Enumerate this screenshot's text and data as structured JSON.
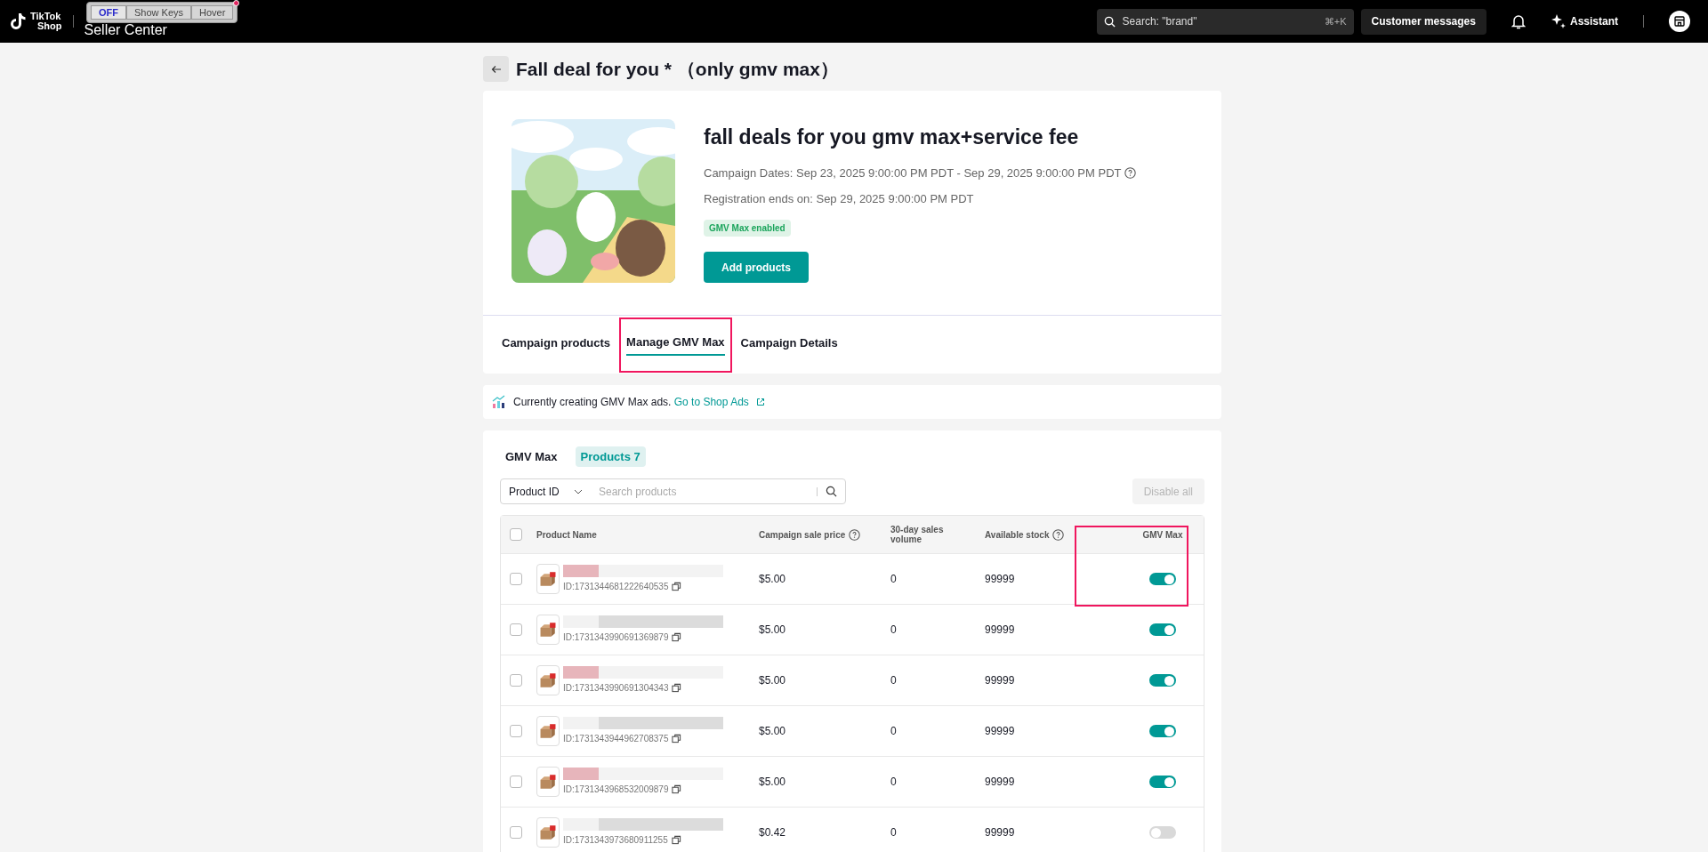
{
  "topbar": {
    "logo_line1": "TikTok",
    "logo_line2": "Shop",
    "app_name": "Seller Center",
    "overlay_toolbar": [
      {
        "label": "OFF",
        "selected": true
      },
      {
        "label": "Show Keys",
        "selected": false
      },
      {
        "label": "Hover",
        "selected": false
      }
    ],
    "search": {
      "placeholder": "Search: \"brand\"",
      "shortcut": "⌘+K"
    },
    "messages_button": "Customer messages",
    "assistant_button": "Assistant"
  },
  "page_title": "Fall deal for you * （only gmv max）",
  "campaign": {
    "title": "fall deals for you gmv max+service fee",
    "dates": "Campaign Dates: Sep 23, 2025 9:00:00 PM PDT - Sep 29, 2025 9:00:00 PM PDT",
    "registration": "Registration ends on: Sep 29, 2025 9:00:00 PM PDT",
    "badge": "GMV Max enabled",
    "add_button": "Add products"
  },
  "tabs": [
    {
      "label": "Campaign products",
      "selected": false
    },
    {
      "label": "Manage GMV Max",
      "selected": true
    },
    {
      "label": "Campaign Details",
      "selected": false
    }
  ],
  "banner": {
    "text": "Currently creating GMV Max ads.",
    "link": "Go to Shop Ads"
  },
  "subtabs": [
    {
      "label": "GMV Max",
      "selected": false
    },
    {
      "label": "Products 7",
      "selected": true
    }
  ],
  "filter": {
    "select": "Product ID",
    "placeholder": "Search products"
  },
  "disable_all": {
    "label": "Disable all",
    "disabled": true
  },
  "table": {
    "select_all_checked": false,
    "columns": [
      "Product Name",
      "Campaign sale price",
      "30-day sales volume",
      "Available stock",
      "GMV Max"
    ],
    "rows": [
      {
        "id": "ID:1731344681222640535",
        "price": "$5.00",
        "sales": "0",
        "stock": "99999",
        "checked": false,
        "gmv_max": true
      },
      {
        "id": "ID:1731343990691369879",
        "price": "$5.00",
        "sales": "0",
        "stock": "99999",
        "checked": false,
        "gmv_max": true
      },
      {
        "id": "ID:1731343990691304343",
        "price": "$5.00",
        "sales": "0",
        "stock": "99999",
        "checked": false,
        "gmv_max": true
      },
      {
        "id": "ID:1731343944962708375",
        "price": "$5.00",
        "sales": "0",
        "stock": "99999",
        "checked": false,
        "gmv_max": true
      },
      {
        "id": "ID:1731343968532009879",
        "price": "$5.00",
        "sales": "0",
        "stock": "99999",
        "checked": false,
        "gmv_max": true
      },
      {
        "id": "ID:1731343973680911255",
        "price": "$0.42",
        "sales": "0",
        "stock": "99999",
        "checked": false,
        "gmv_max": false
      }
    ]
  }
}
